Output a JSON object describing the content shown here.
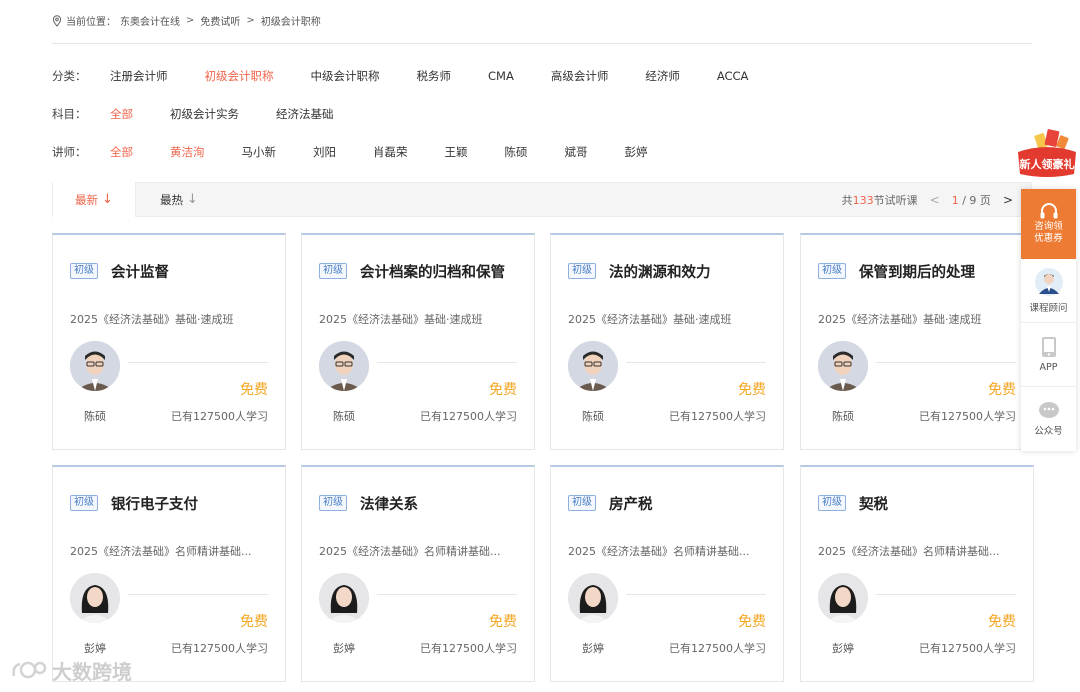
{
  "breadcrumb": {
    "prefix": "当前位置：",
    "items": [
      "东奥会计在线",
      "免费试听",
      "初级会计职称"
    ],
    "sep1": ">",
    "sep2": ">"
  },
  "filters": {
    "category": {
      "label": "分类：",
      "options": [
        "注册会计师",
        "初级会计职称",
        "中级会计职称",
        "税务师",
        "CMA",
        "高级会计师",
        "经济师",
        "ACCA"
      ],
      "active": "初级会计职称"
    },
    "subject": {
      "label": "科目：",
      "options": [
        "全部",
        "初级会计实务",
        "经济法基础"
      ],
      "active": "全部"
    },
    "teacher": {
      "label": "讲师：",
      "options": [
        "全部",
        "黄洁洵",
        "马小新",
        "刘阳",
        "肖磊荣",
        "王颖",
        "陈硕",
        "斌哥",
        "彭婷"
      ],
      "active": [
        "全部",
        "黄洁洵"
      ]
    }
  },
  "sort": {
    "newest": "最新",
    "hottest": "最热",
    "newest_arrow": "↓",
    "hottest_arrow": "↓",
    "total_prefix": "共",
    "total_count": "133",
    "total_suffix": "节试听课",
    "prev": "<",
    "current_page": "1",
    "page_total": "/ 9 页",
    "next": ">"
  },
  "courses": [
    {
      "tag": "初级",
      "title": "会计监督",
      "subtitle": "2025《经济法基础》基础·速成班",
      "price": "免费",
      "teacher": "陈硕",
      "learners": "已有127500人学习"
    },
    {
      "tag": "初级",
      "title": "会计档案的归档和保管",
      "subtitle": "2025《经济法基础》基础·速成班",
      "price": "免费",
      "teacher": "陈硕",
      "learners": "已有127500人学习"
    },
    {
      "tag": "初级",
      "title": "法的渊源和效力",
      "subtitle": "2025《经济法基础》基础·速成班",
      "price": "免费",
      "teacher": "陈硕",
      "learners": "已有127500人学习"
    },
    {
      "tag": "初级",
      "title": "保管到期后的处理",
      "subtitle": "2025《经济法基础》基础·速成班",
      "price": "免费",
      "teacher": "陈硕",
      "learners": "已有127500人学习"
    },
    {
      "tag": "初级",
      "title": "银行电子支付",
      "subtitle": "2025《经济法基础》名师精讲基础...",
      "price": "免费",
      "teacher": "彭婷",
      "learners": "已有127500人学习"
    },
    {
      "tag": "初级",
      "title": "法律关系",
      "subtitle": "2025《经济法基础》名师精讲基础...",
      "price": "免费",
      "teacher": "彭婷",
      "learners": "已有127500人学习"
    },
    {
      "tag": "初级",
      "title": "房产税",
      "subtitle": "2025《经济法基础》名师精讲基础...",
      "price": "免费",
      "teacher": "彭婷",
      "learners": "已有127500人学习"
    },
    {
      "tag": "初级",
      "title": "契税",
      "subtitle": "2025《经济法基础》名师精讲基础...",
      "price": "免费",
      "teacher": "彭婷",
      "learners": "已有127500人学习"
    }
  ],
  "sidebar": {
    "gift_label": "新人领豪礼",
    "consult_line1": "咨询领",
    "consult_line2": "优惠券",
    "advisor": "课程顾问",
    "app": "APP",
    "wechat": "公众号"
  },
  "watermark": "大数跨境",
  "colors": {
    "accent": "#f0644a",
    "price": "#f5a623",
    "tag": "#4b7fc6",
    "side_orange": "#ee7b33"
  }
}
